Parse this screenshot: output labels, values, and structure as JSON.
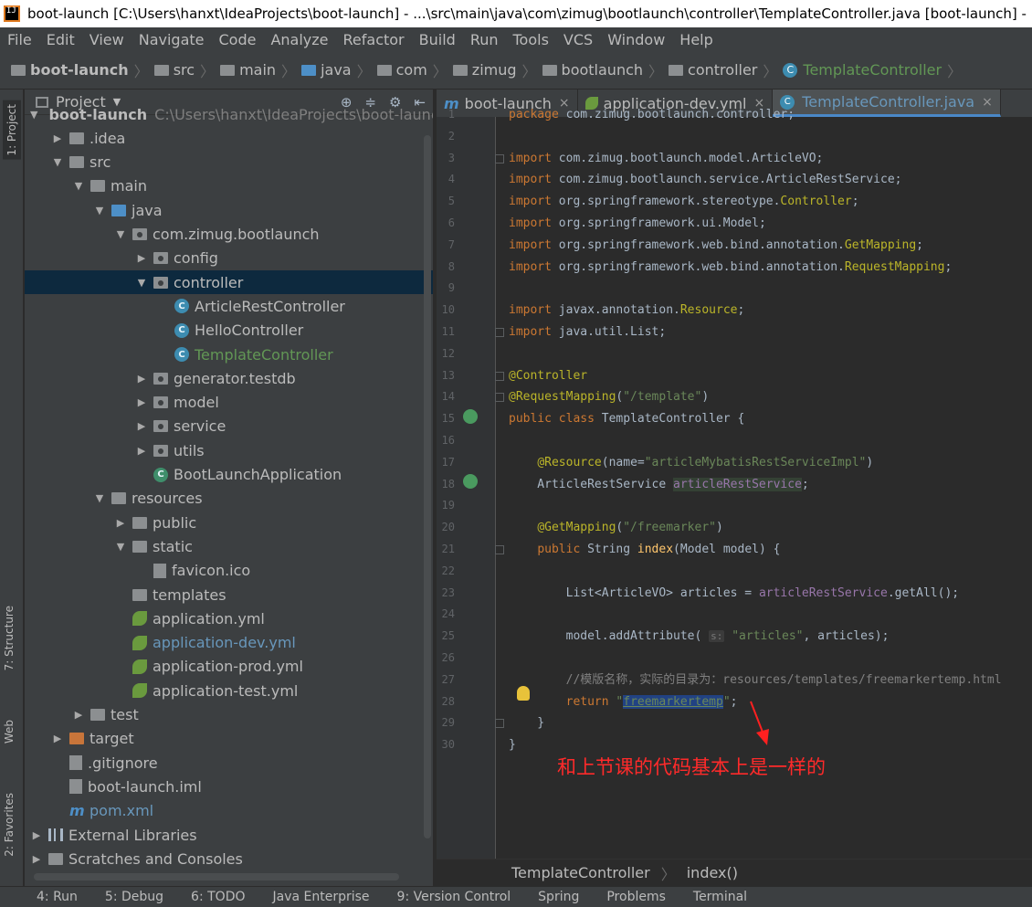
{
  "window": {
    "title": "boot-launch [C:\\Users\\hanxt\\IdeaProjects\\boot-launch] - ...\\src\\main\\java\\com\\zimug\\bootlaunch\\controller\\TemplateController.java [boot-launch] - Inte"
  },
  "menu": [
    "File",
    "Edit",
    "View",
    "Navigate",
    "Code",
    "Analyze",
    "Refactor",
    "Build",
    "Run",
    "Tools",
    "VCS",
    "Window",
    "Help"
  ],
  "breadcrumb": [
    "boot-launch",
    "src",
    "main",
    "java",
    "com",
    "zimug",
    "bootlaunch",
    "controller",
    "TemplateController"
  ],
  "sidebar_tabs": [
    "1: Project",
    "7: Structure",
    "Web",
    "2: Favorites"
  ],
  "project_panel": {
    "title": "Project",
    "tree": [
      {
        "label": "boot-launch",
        "suffix": "C:\\Users\\hanxt\\IdeaProjects\\boot-launch",
        "depth": 0,
        "arrow": "open",
        "icon": "folder"
      },
      {
        "label": ".idea",
        "depth": 1,
        "arrow": "closed",
        "icon": "folder"
      },
      {
        "label": "src",
        "depth": 1,
        "arrow": "open",
        "icon": "folder"
      },
      {
        "label": "main",
        "depth": 2,
        "arrow": "open",
        "icon": "folder"
      },
      {
        "label": "java",
        "depth": 3,
        "arrow": "open",
        "icon": "folder-blue"
      },
      {
        "label": "com.zimug.bootlaunch",
        "depth": 4,
        "arrow": "open",
        "icon": "package"
      },
      {
        "label": "config",
        "depth": 5,
        "arrow": "closed",
        "icon": "package"
      },
      {
        "label": "controller",
        "depth": 5,
        "arrow": "open",
        "icon": "package",
        "selected": true
      },
      {
        "label": "ArticleRestController",
        "depth": 6,
        "arrow": "",
        "icon": "class"
      },
      {
        "label": "HelloController",
        "depth": 6,
        "arrow": "",
        "icon": "class"
      },
      {
        "label": "TemplateController",
        "depth": 6,
        "arrow": "",
        "icon": "class",
        "color": "green"
      },
      {
        "label": "generator.testdb",
        "depth": 5,
        "arrow": "closed",
        "icon": "package"
      },
      {
        "label": "model",
        "depth": 5,
        "arrow": "closed",
        "icon": "package"
      },
      {
        "label": "service",
        "depth": 5,
        "arrow": "closed",
        "icon": "package"
      },
      {
        "label": "utils",
        "depth": 5,
        "arrow": "closed",
        "icon": "package"
      },
      {
        "label": "BootLaunchApplication",
        "depth": 5,
        "arrow": "",
        "icon": "spring-class"
      },
      {
        "label": "resources",
        "depth": 3,
        "arrow": "open",
        "icon": "folder"
      },
      {
        "label": "public",
        "depth": 4,
        "arrow": "closed",
        "icon": "folder"
      },
      {
        "label": "static",
        "depth": 4,
        "arrow": "open",
        "icon": "folder"
      },
      {
        "label": "favicon.ico",
        "depth": 5,
        "arrow": "",
        "icon": "file"
      },
      {
        "label": "templates",
        "depth": 4,
        "arrow": "",
        "icon": "folder"
      },
      {
        "label": "application.yml",
        "depth": 4,
        "arrow": "",
        "icon": "yml"
      },
      {
        "label": "application-dev.yml",
        "depth": 4,
        "arrow": "",
        "icon": "yml",
        "color": "blue"
      },
      {
        "label": "application-prod.yml",
        "depth": 4,
        "arrow": "",
        "icon": "yml"
      },
      {
        "label": "application-test.yml",
        "depth": 4,
        "arrow": "",
        "icon": "yml"
      },
      {
        "label": "test",
        "depth": 2,
        "arrow": "closed",
        "icon": "folder"
      },
      {
        "label": "target",
        "depth": 1,
        "arrow": "closed",
        "icon": "folder-orange"
      },
      {
        "label": ".gitignore",
        "depth": 1,
        "arrow": "",
        "icon": "file"
      },
      {
        "label": "boot-launch.iml",
        "depth": 1,
        "arrow": "",
        "icon": "file"
      },
      {
        "label": "pom.xml",
        "depth": 1,
        "arrow": "",
        "icon": "maven",
        "color": "blue"
      },
      {
        "label": "External Libraries",
        "depth": 0,
        "arrow": "closed",
        "icon": "library"
      },
      {
        "label": "Scratches and Consoles",
        "depth": 0,
        "arrow": "closed",
        "icon": "folder"
      }
    ]
  },
  "editor": {
    "tabs": [
      {
        "label": "boot-launch",
        "icon": "m"
      },
      {
        "label": "application-dev.yml",
        "icon": "spring"
      },
      {
        "label": "TemplateController.java",
        "icon": "class",
        "active": true
      }
    ],
    "lines": [
      {
        "n": "1",
        "html": "<span class=\"kw\">package</span> com.zimug.bootlaunch.controller;"
      },
      {
        "n": "2",
        "html": ""
      },
      {
        "n": "3",
        "html": "<span class=\"kw\">import</span> com.zimug.bootlaunch.model.ArticleVO;"
      },
      {
        "n": "4",
        "html": "<span class=\"kw\">import</span> com.zimug.bootlaunch.service.ArticleRestService;"
      },
      {
        "n": "5",
        "html": "<span class=\"kw\">import</span> org.springframework.stereotype.<span class=\"typ\">Controller</span>;"
      },
      {
        "n": "6",
        "html": "<span class=\"kw\">import</span> org.springframework.ui.Model;"
      },
      {
        "n": "7",
        "html": "<span class=\"kw\">import</span> org.springframework.web.bind.annotation.<span class=\"typ\">GetMapping</span>;"
      },
      {
        "n": "8",
        "html": "<span class=\"kw\">import</span> org.springframework.web.bind.annotation.<span class=\"typ\">RequestMapping</span>;"
      },
      {
        "n": "9",
        "html": ""
      },
      {
        "n": "10",
        "html": "<span class=\"kw\">import</span> javax.annotation.<span class=\"typ\">Resource</span>;"
      },
      {
        "n": "11",
        "html": "<span class=\"kw\">import</span> java.util.List;"
      },
      {
        "n": "12",
        "html": ""
      },
      {
        "n": "13",
        "html": "<span class=\"ann\">@Controller</span>"
      },
      {
        "n": "14",
        "html": "<span class=\"ann\">@RequestMapping</span>(<span class=\"str\">\"/template\"</span>)"
      },
      {
        "n": "15",
        "html": "<span class=\"kw\">public class</span> TemplateController {"
      },
      {
        "n": "16",
        "html": ""
      },
      {
        "n": "17",
        "html": "    <span class=\"ann\">@Resource</span>(name=<span class=\"str\">\"articleMybatisRestServiceImpl\"</span>)"
      },
      {
        "n": "18",
        "html": "    ArticleRestService <span class=\"field hl\">articleRestService</span>;"
      },
      {
        "n": "19",
        "html": ""
      },
      {
        "n": "20",
        "html": "    <span class=\"ann\">@GetMapping</span>(<span class=\"str\">\"/freemarker\"</span>)"
      },
      {
        "n": "21",
        "html": "    <span class=\"kw\">public</span> String <span class=\"fn\">index</span>(Model model) {"
      },
      {
        "n": "22",
        "html": ""
      },
      {
        "n": "23",
        "html": "        List&lt;ArticleVO&gt; articles = <span class=\"field\">articleRestService</span>.getAll();"
      },
      {
        "n": "24",
        "html": ""
      },
      {
        "n": "25",
        "html": "        model.addAttribute( <span class=\"hint\">s:</span> <span class=\"str\">\"articles\"</span>, articles);"
      },
      {
        "n": "26",
        "html": ""
      },
      {
        "n": "27",
        "html": "        <span class=\"cmt\">//模版名称，实际的目录为：resources/templates/freemarkertemp.html</span>"
      },
      {
        "n": "28",
        "html": "        <span class=\"kw\">return</span> <span class=\"str\">\"<span class=\"selword\">freemarkertemp</span>\"</span>;"
      },
      {
        "n": "29",
        "html": "    }"
      },
      {
        "n": "30",
        "html": "}"
      }
    ],
    "annotation_text": "和上节课的代码基本上是一样的",
    "breadcrumb_bottom": [
      "TemplateController",
      "index()"
    ]
  },
  "bottom_tools": [
    "4: Run",
    "5: Debug",
    "6: TODO",
    "Java Enterprise",
    "9: Version Control",
    "Spring",
    "Problems",
    "Terminal"
  ]
}
